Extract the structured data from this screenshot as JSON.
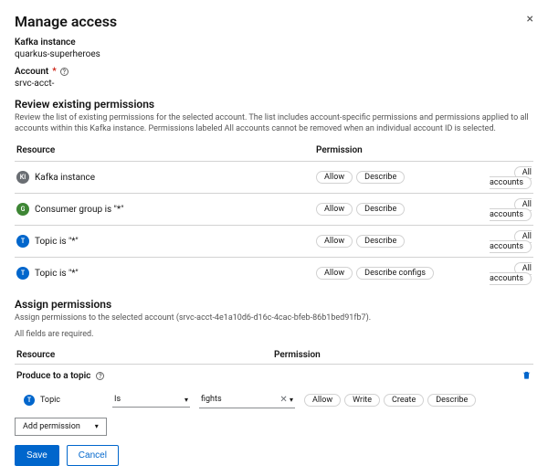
{
  "header": {
    "title": "Manage access",
    "close_label": "×",
    "kafka_label": "Kafka instance",
    "kafka_value": "quarkus-superheroes",
    "account_label": "Account",
    "account_required": "*",
    "account_value": "srvc-acct-"
  },
  "review": {
    "title": "Review existing permissions",
    "desc": "Review the list of existing permissions for the selected account. The list includes account-specific permissions and permissions applied to all accounts within this Kafka instance. Permissions labeled All accounts cannot be removed when an individual account ID is selected.",
    "columns": {
      "resource": "Resource",
      "permission": "Permission",
      "scope": ""
    },
    "rows": [
      {
        "icon": "KI",
        "icon_class": "ki",
        "resource": "Kafka instance",
        "perms": [
          "Allow",
          "Describe"
        ],
        "scope": "All accounts"
      },
      {
        "icon": "G",
        "icon_class": "cg",
        "resource": "Consumer group is \"*\"",
        "perms": [
          "Allow",
          "Describe"
        ],
        "scope": "All accounts"
      },
      {
        "icon": "T",
        "icon_class": "tp",
        "resource": "Topic is \"*\"",
        "perms": [
          "Allow",
          "Describe"
        ],
        "scope": "All accounts"
      },
      {
        "icon": "T",
        "icon_class": "tp",
        "resource": "Topic is \"*\"",
        "perms": [
          "Allow",
          "Describe configs"
        ],
        "scope": "All accounts"
      }
    ]
  },
  "assign": {
    "title": "Assign permissions",
    "desc": "Assign permissions to the selected account (srvc-acct-4e1a10d6-d16c-4cac-bfeb-86b1bed91fb7).",
    "all_required": "All fields are required.",
    "columns": {
      "resource": "Resource",
      "permission": "Permission"
    },
    "template_label": "Produce to a topic",
    "row": {
      "chip_icon": "T",
      "chip_label": "Topic",
      "operator": "Is",
      "value": "fights",
      "perms": [
        "Allow",
        "Write",
        "Create",
        "Describe"
      ]
    },
    "add_label": "Add permission"
  },
  "footer": {
    "save": "Save",
    "cancel": "Cancel"
  }
}
